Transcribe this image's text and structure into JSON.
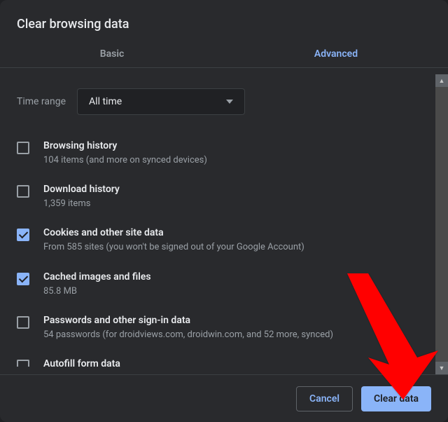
{
  "title": "Clear browsing data",
  "tabs": {
    "basic": "Basic",
    "advanced": "Advanced"
  },
  "time": {
    "label": "Time range",
    "value": "All time"
  },
  "options": [
    {
      "title": "Browsing history",
      "sub": "104 items (and more on synced devices)",
      "checked": false
    },
    {
      "title": "Download history",
      "sub": "1,359 items",
      "checked": false
    },
    {
      "title": "Cookies and other site data",
      "sub": "From 585 sites (you won't be signed out of your Google Account)",
      "checked": true
    },
    {
      "title": "Cached images and files",
      "sub": "85.8 MB",
      "checked": true
    },
    {
      "title": "Passwords and other sign-in data",
      "sub": "54 passwords (for droidviews.com, droidwin.com, and 52 more, synced)",
      "checked": false
    },
    {
      "title": "Autofill form data",
      "sub": "",
      "checked": false
    }
  ],
  "buttons": {
    "cancel": "Cancel",
    "clear": "Clear data"
  }
}
